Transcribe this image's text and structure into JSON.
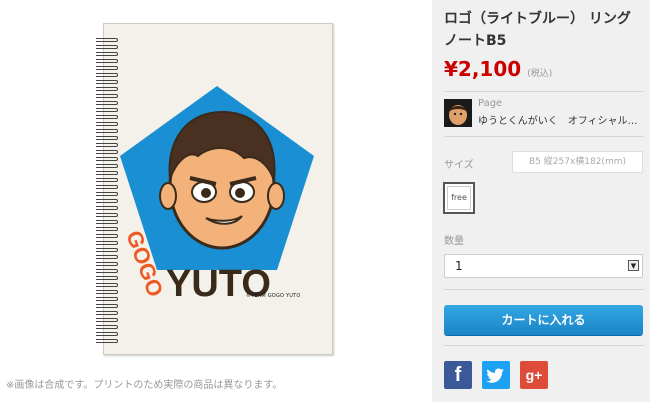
{
  "product": {
    "title": "ロゴ（ライトブルー） リングノートB5",
    "price": "¥2,100",
    "tax_note": "(税込)"
  },
  "artwork": {
    "logo_vertical": "GOGO",
    "logo_main": "YUTO",
    "copyright": "©TEAM GOGO YUTO",
    "colors": {
      "pentagon": "#1a8fd4",
      "orange": "#ee5a24",
      "dark": "#3a2a1a"
    }
  },
  "caption": "※画像は合成です。プリントのため実際の商品は異なります。",
  "seller": {
    "label": "Page",
    "name": "ゆうとくんがいく　オフィシャル…"
  },
  "options": {
    "size_label": "サイズ",
    "size_value": "B5 縦257x横182(mm)",
    "variant_label": "free",
    "quantity_label": "数量",
    "quantity_value": "1"
  },
  "cart_button": "カートに入れる",
  "social": {
    "facebook": "f",
    "twitter": "twitter-bird-icon",
    "google_plus": "g+"
  },
  "colors": {
    "price": "#cc0000",
    "button": "#1a85c7",
    "facebook": "#3b5998",
    "twitter": "#1da1f2",
    "google": "#dd4b39"
  }
}
